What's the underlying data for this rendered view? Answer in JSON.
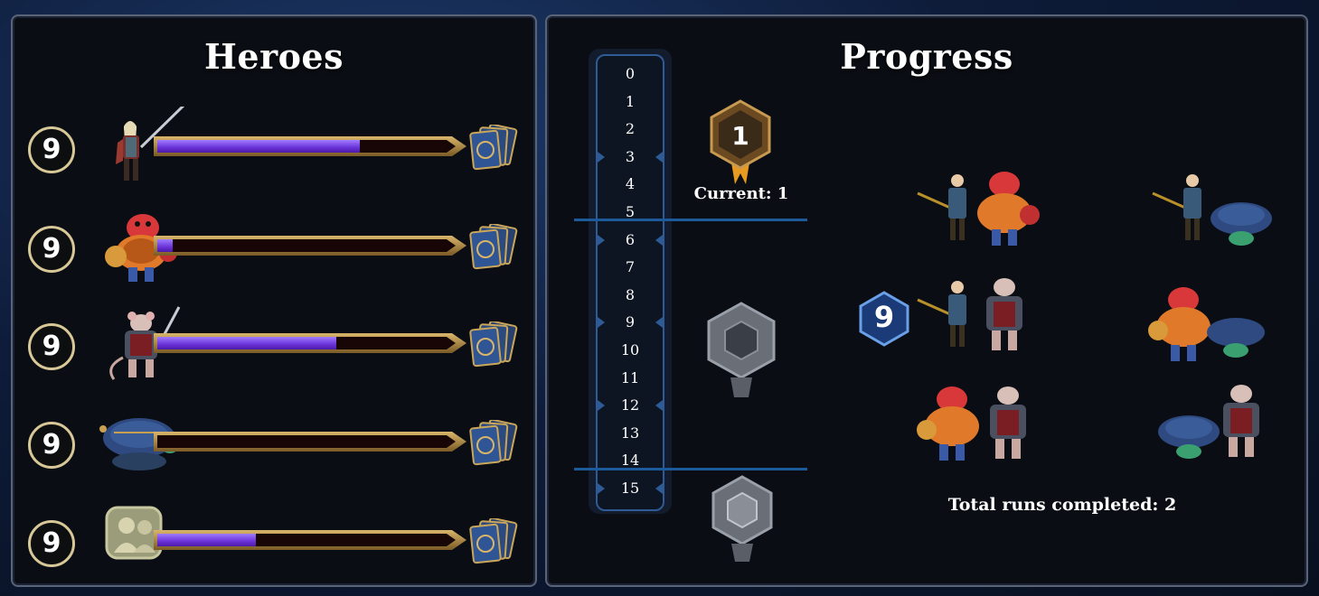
{
  "heroes_panel": {
    "title": "Heroes",
    "rows": [
      {
        "level": "9",
        "portrait": "swordswoman-hero",
        "xp_fraction": 0.68,
        "deck_icon": "card-deck-icon"
      },
      {
        "level": "9",
        "portrait": "red-ogre-hero",
        "xp_fraction": 0.05,
        "deck_icon": "card-deck-icon"
      },
      {
        "level": "9",
        "portrait": "rat-warrior-hero",
        "xp_fraction": 0.6,
        "deck_icon": "card-deck-icon"
      },
      {
        "level": "9",
        "portrait": "turtle-hero",
        "xp_fraction": 0.0,
        "deck_icon": "card-deck-icon"
      },
      {
        "level": "9",
        "portrait": "party-group-icon",
        "xp_fraction": 0.33,
        "deck_icon": "card-deck-icon"
      }
    ]
  },
  "progress_panel": {
    "title": "Progress",
    "track_levels": [
      "0",
      "1",
      "2",
      "3",
      "4",
      "5",
      "6",
      "7",
      "8",
      "9",
      "10",
      "11",
      "12",
      "13",
      "14",
      "15"
    ],
    "current_rank": "1",
    "current_label": "Current: 1",
    "level_badge": "9",
    "parties": [
      [
        "mage-hero",
        "red-ogre-hero"
      ],
      [
        "mage-hero",
        "turtle-hero"
      ],
      [
        "mage-hero",
        "rat-warrior-hero"
      ],
      [
        "red-ogre-hero",
        "turtle-hero"
      ],
      [
        "red-ogre-hero",
        "rat-warrior-hero"
      ],
      [
        "turtle-hero",
        "rat-warrior-hero"
      ]
    ],
    "total_runs_label": "Total runs completed: 2"
  },
  "colors": {
    "xp_fill": "#7a44e8",
    "bar_frame": "#c9a45a",
    "track_border": "#2e5a96",
    "divider": "#1c5a9a"
  }
}
